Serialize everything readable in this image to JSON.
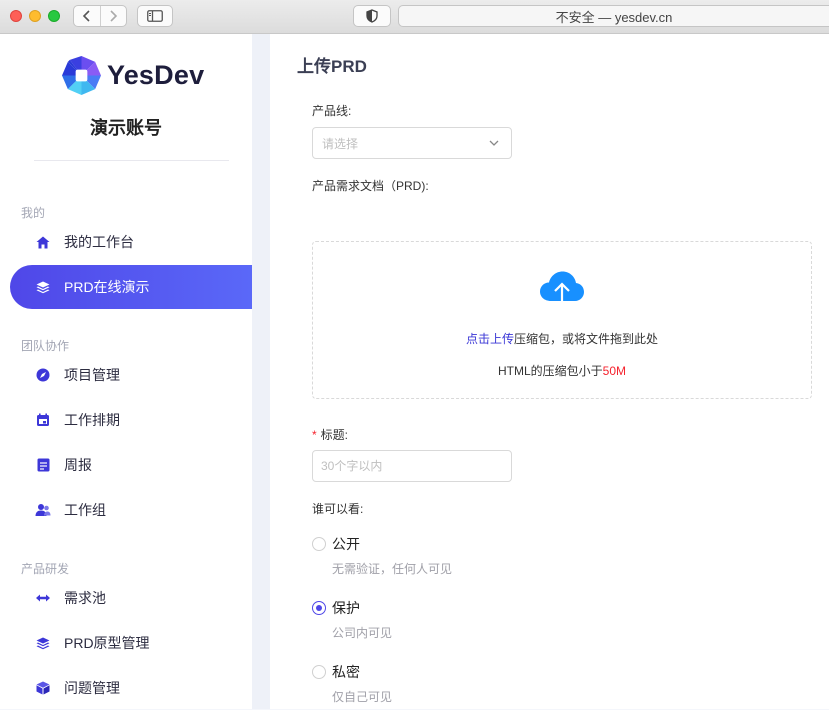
{
  "browser": {
    "url_text": "不安全 — yesdev.cn"
  },
  "sidebar": {
    "logo_text": "YesDev",
    "account_name": "演示账号",
    "sections": [
      {
        "title": "我的"
      },
      {
        "title": "团队协作"
      },
      {
        "title": "产品研发"
      }
    ],
    "items": [
      {
        "label": "我的工作台",
        "icon": "home-icon"
      },
      {
        "label": "PRD在线演示",
        "icon": "layers-icon",
        "active": true
      },
      {
        "label": "项目管理",
        "icon": "compass-icon"
      },
      {
        "label": "工作排期",
        "icon": "calendar-icon"
      },
      {
        "label": "周报",
        "icon": "report-icon"
      },
      {
        "label": "工作组",
        "icon": "team-icon"
      },
      {
        "label": "需求池",
        "icon": "arrows-icon"
      },
      {
        "label": "PRD原型管理",
        "icon": "layers-icon"
      },
      {
        "label": "问题管理",
        "icon": "cube-icon"
      }
    ]
  },
  "main": {
    "title": "上传PRD",
    "product_line": {
      "label": "产品线:",
      "placeholder": "请选择"
    },
    "prd_doc": {
      "label": "产品需求文档（PRD):",
      "upload_link": "点击上传",
      "upload_hint_rest": "压缩包，或将文件拖到此处",
      "limit_text": "HTML的压缩包小于",
      "limit_value": "50M"
    },
    "title_field": {
      "required_mark": "*",
      "label": "标题:",
      "placeholder": "30个字以内"
    },
    "visibility": {
      "label": "谁可以看:",
      "options": [
        {
          "label": "公开",
          "desc": "无需验证，任何人可见",
          "checked": false
        },
        {
          "label": "保护",
          "desc": "公司内可见",
          "checked": true
        },
        {
          "label": "私密",
          "desc": "仅自己可见",
          "checked": false
        }
      ]
    }
  },
  "colors": {
    "accent": "#4f47e8",
    "required": "#f5222d",
    "icon": "#3d37d8"
  }
}
